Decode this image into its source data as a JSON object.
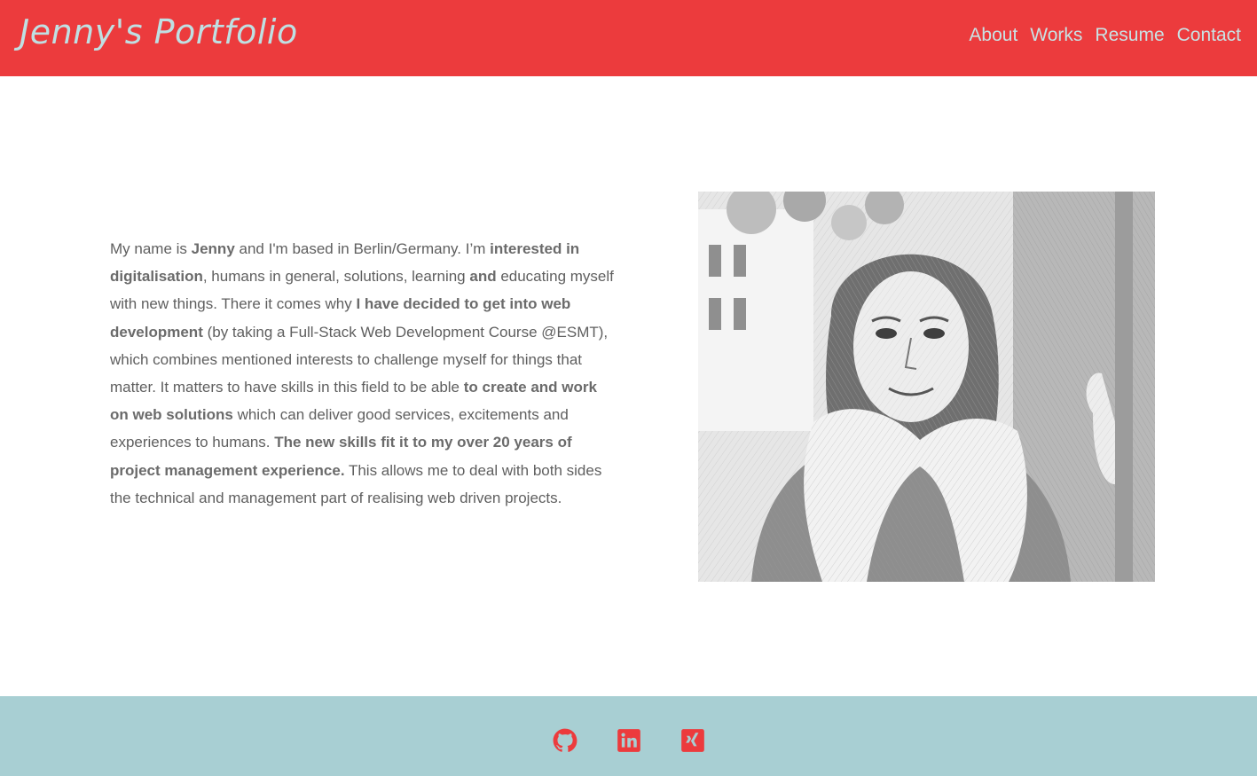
{
  "header": {
    "brand": "Jenny's Portfolio",
    "nav": [
      {
        "label": "About"
      },
      {
        "label": "Works"
      },
      {
        "label": "Resume"
      },
      {
        "label": "Contact"
      }
    ]
  },
  "about": {
    "segments": [
      {
        "text": "My name is ",
        "bold": false
      },
      {
        "text": "Jenny",
        "bold": true
      },
      {
        "text": " and I'm based in Berlin/Germany. I’m ",
        "bold": false
      },
      {
        "text": "interested in digitalisation",
        "bold": true
      },
      {
        "text": ", humans in general, solutions, learning ",
        "bold": false
      },
      {
        "text": "and",
        "bold": true
      },
      {
        "text": " educating myself with new things. There it comes why ",
        "bold": false
      },
      {
        "text": "I have decided to get into web development",
        "bold": true
      },
      {
        "text": " (by taking a Full-Stack Web Development Course @ESMT), which combines mentioned interests to challenge myself for things that matter. It matters to have skills in this field to be able ",
        "bold": false
      },
      {
        "text": "to create and work on web solutions",
        "bold": true
      },
      {
        "text": " which can deliver good services, excitements and experiences to humans. ",
        "bold": false
      },
      {
        "text": "The new skills fit it to my over 20 years of project management experience.",
        "bold": true
      },
      {
        "text": " This allows me to deal with both sides the technical and management part of realising web driven projects.",
        "bold": false
      }
    ]
  },
  "footer": {
    "icons": [
      "github-icon",
      "linkedin-icon",
      "xing-icon"
    ],
    "icon_color": "#ec3b3d"
  },
  "colors": {
    "header_bg": "#ec3b3d",
    "nav_text": "#c9e2e4",
    "footer_bg": "#a8cfd3",
    "body_text": "#5f5f5f"
  }
}
